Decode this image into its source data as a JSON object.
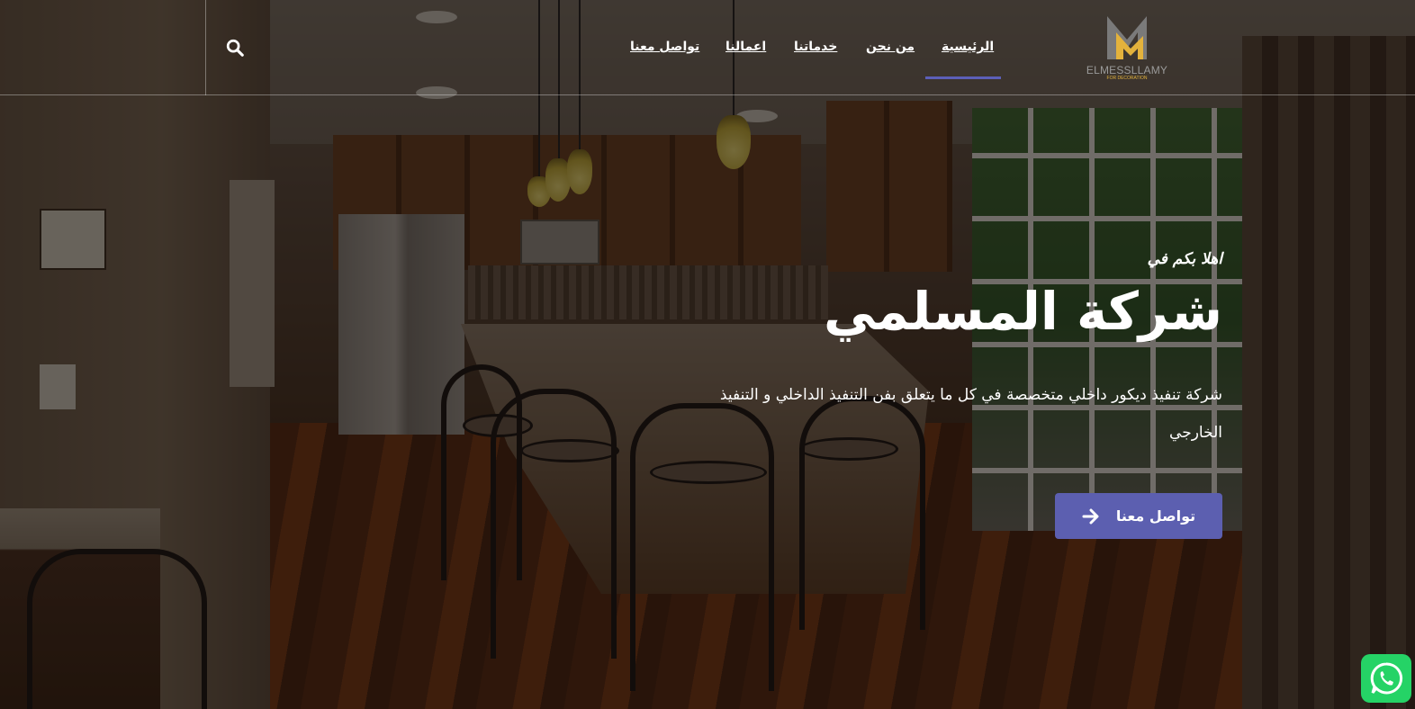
{
  "header": {
    "brand": {
      "name": "ELMESSLLAMY",
      "tagline": "FOR DECORATION",
      "logo_icon": "m-monogram-logo",
      "gold": "#e3b23c",
      "gray": "#7a7a7a"
    },
    "nav": [
      {
        "label": "الرئيسية",
        "active": true
      },
      {
        "label": "من نحن"
      },
      {
        "label": "خدماتنا"
      },
      {
        "label": "اعمالنا"
      },
      {
        "label": "تواصل معنا"
      }
    ],
    "search_icon": "search-icon",
    "active_underline_color": "#5c5fb8"
  },
  "hero": {
    "kicker": "اهلا بكم في",
    "title": "شركة المسلمي",
    "description": "شركة تنفيذ ديكور داخلي متخصصة في كل ما يتعلق بفن التنفيذ الداخلي و التنفيذ الخارجي",
    "cta": {
      "label": "تواصل معنا",
      "icon": "arrow-right-icon",
      "color": "#5c5fb0"
    }
  },
  "floating": {
    "whatsapp_icon": "whatsapp-icon",
    "color": "#25d366"
  }
}
